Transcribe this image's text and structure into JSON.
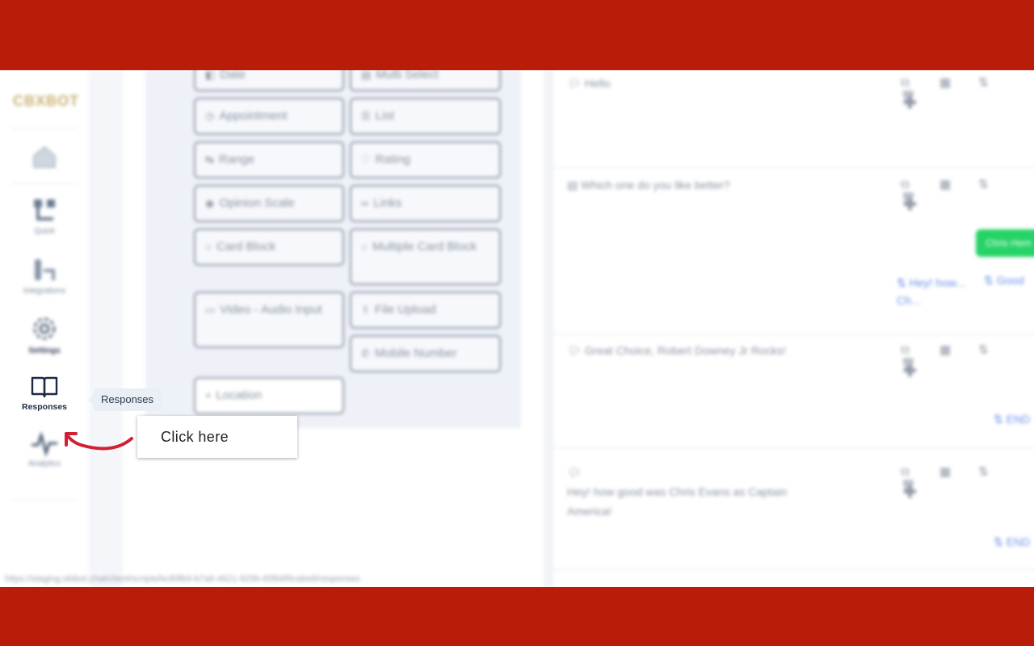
{
  "app": {
    "logo": "CBXBOT",
    "url": "https://staging.obibot.chat/client/scripts/bc89fb9-b7a6-4621-929b-65fb6f9cabe8/responses"
  },
  "sidebar": {
    "items": [
      {
        "label": ""
      },
      {
        "label": "Quick"
      },
      {
        "label": "Integrations"
      },
      {
        "label": "Settings"
      },
      {
        "label": "Responses"
      },
      {
        "label": "Analytics"
      }
    ]
  },
  "blocks": [
    {
      "label": "Date"
    },
    {
      "label": "Multi Select"
    },
    {
      "label": "Appointment"
    },
    {
      "label": "List"
    },
    {
      "label": "Range"
    },
    {
      "label": "Rating"
    },
    {
      "label": "Opinion Scale"
    },
    {
      "label": "Links"
    },
    {
      "label": "Card Block"
    },
    {
      "label": "Multiple Card Block"
    },
    {
      "label": "Video - Audio Input"
    },
    {
      "label": "File Upload"
    },
    {
      "label": "Mobile Number"
    },
    {
      "label": "Location"
    }
  ],
  "flow": {
    "messages": [
      {
        "text": "Hello"
      },
      {
        "text": "Which one do you like better?"
      },
      {
        "text": "Great Choice, Robert Downey Jr Rocks!"
      },
      {
        "text": "Hey! how good was Chris Evans as Captain America!"
      }
    ],
    "green_button": "Chris Hem",
    "links": [
      {
        "text": "Hey! how... Ch..."
      },
      {
        "text": "Good"
      },
      {
        "text": "END"
      },
      {
        "text": "END"
      }
    ]
  },
  "tooltip": {
    "text": "Responses"
  },
  "callout": {
    "text": "Click here"
  },
  "colors": {
    "frame": "#b91c08",
    "arrow": "#d21f35",
    "accent_green": "#25d366",
    "link_blue": "#6b8fe8"
  }
}
